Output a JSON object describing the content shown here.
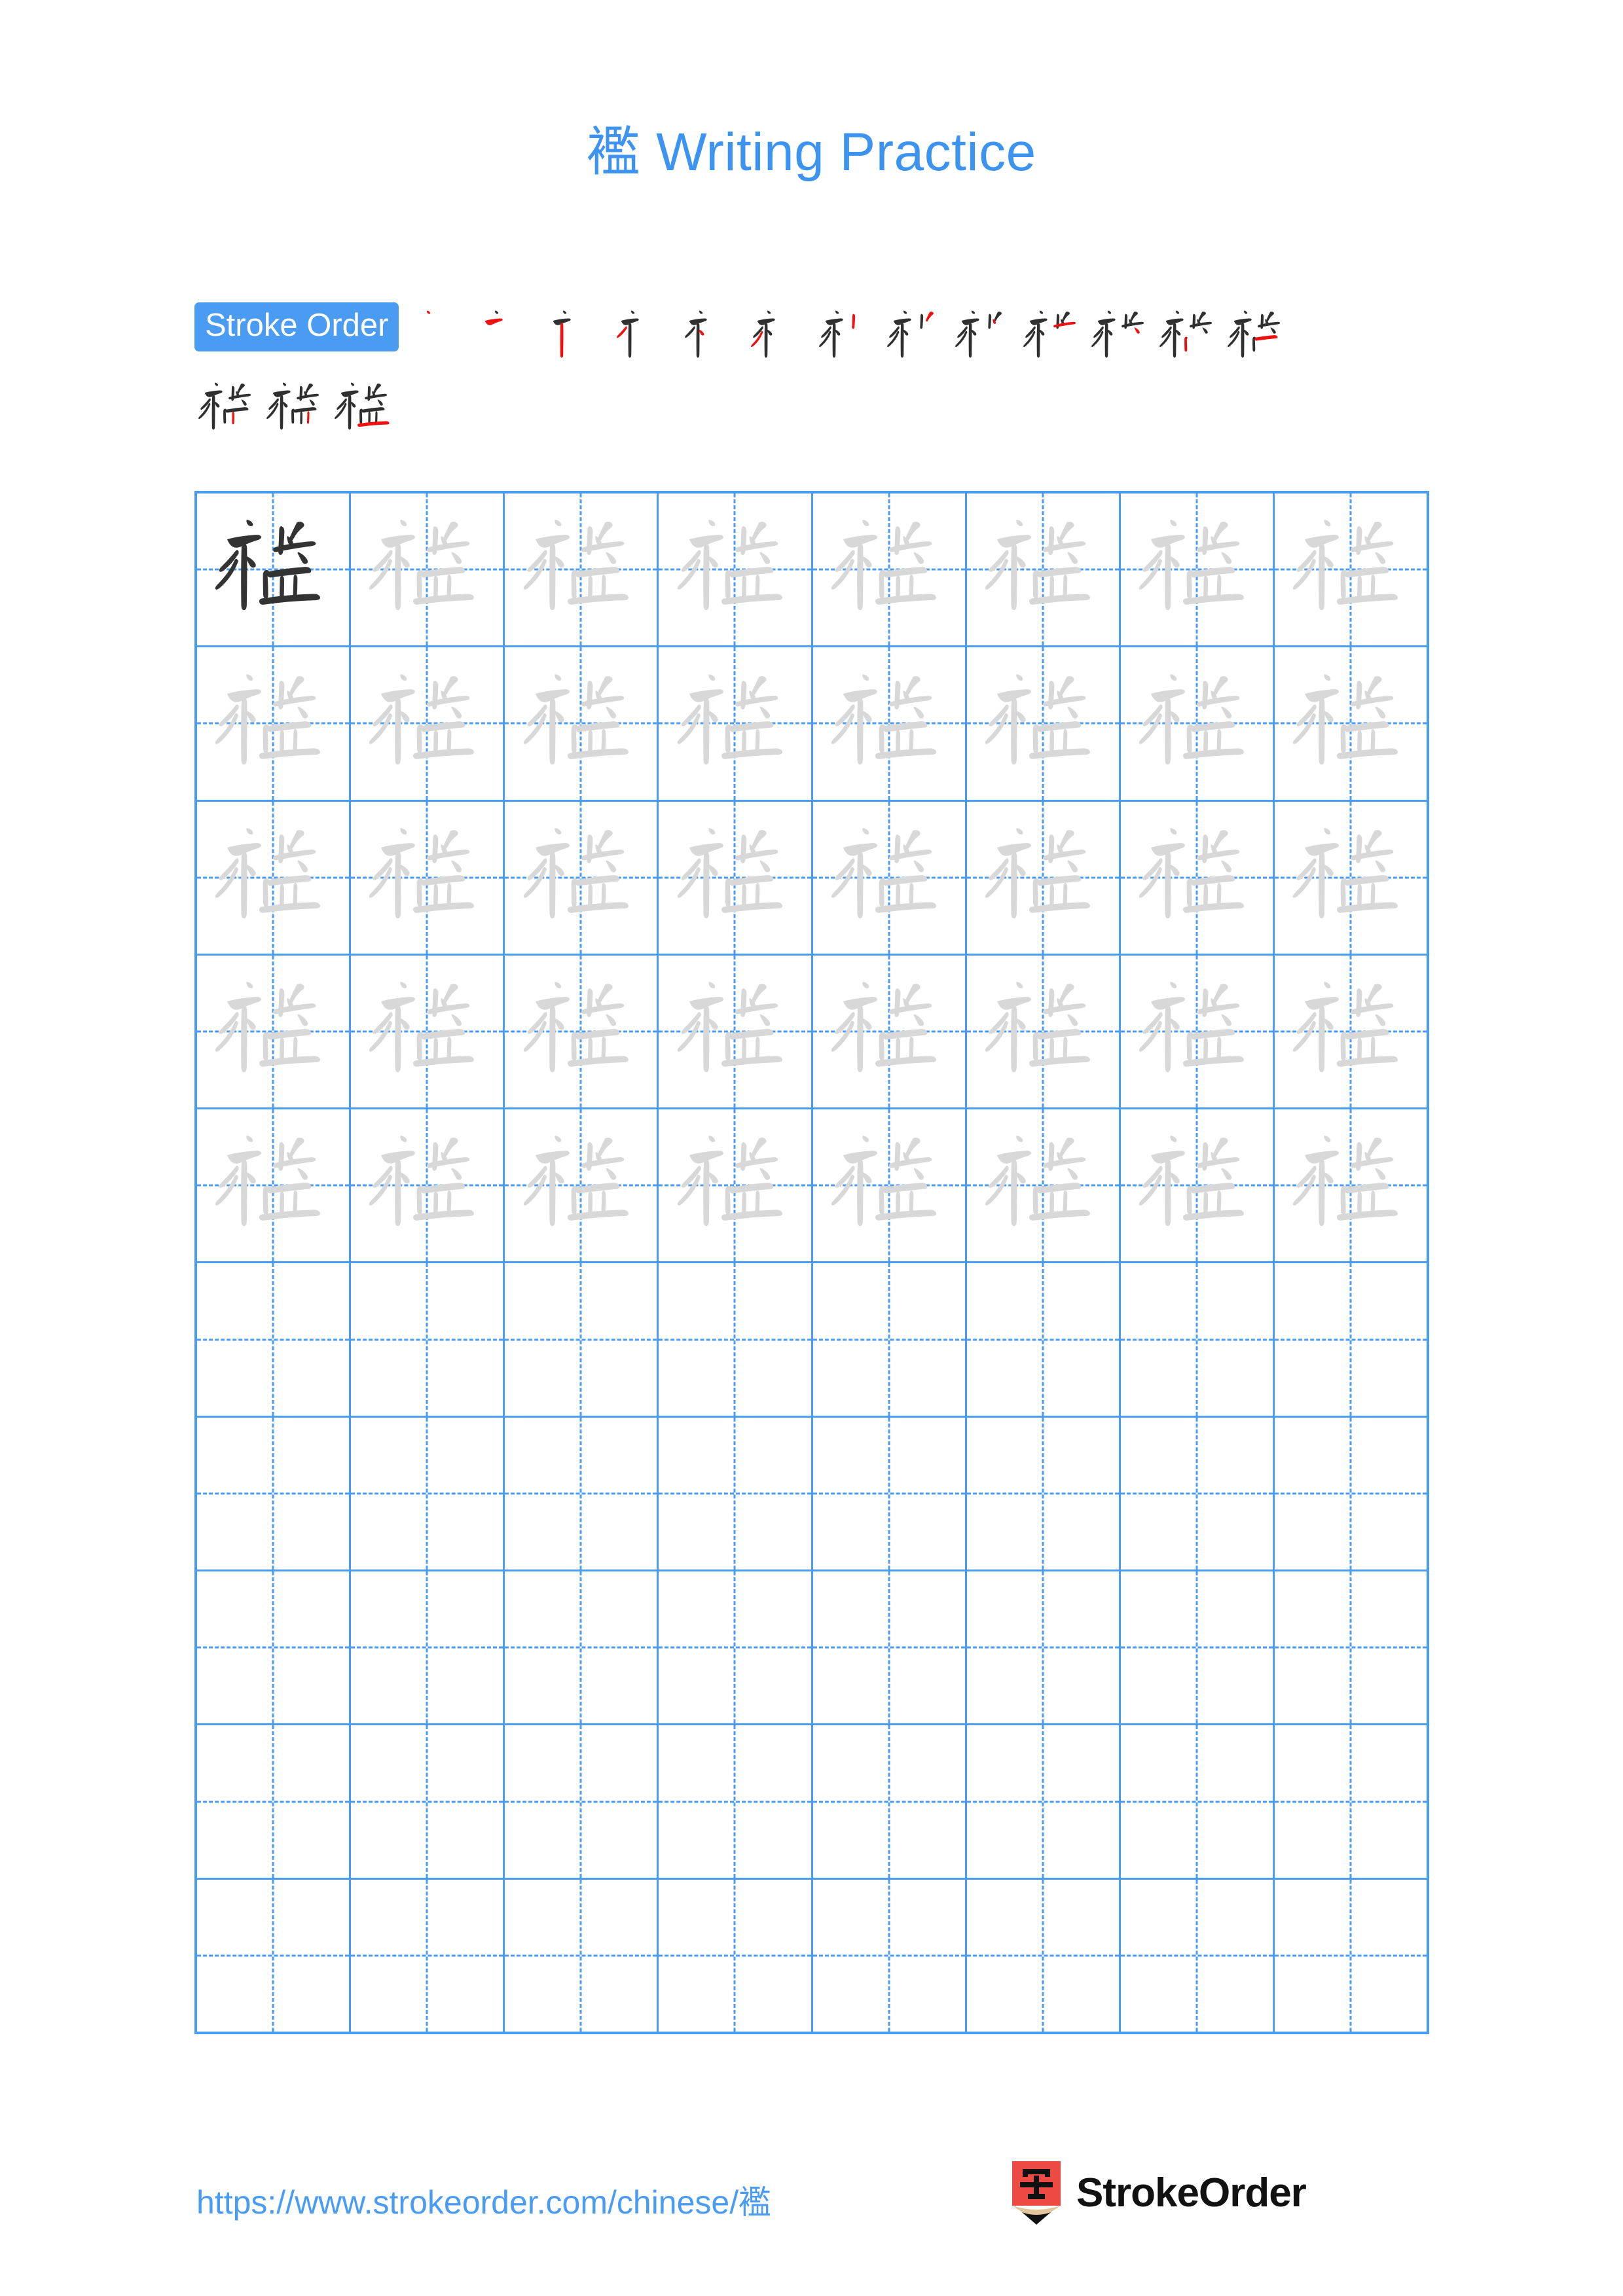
{
  "page": {
    "character": "襤",
    "title_suffix": " Writing Practice",
    "title_full": "襤 Writing Practice",
    "accent_color": "#4a9bf2",
    "trace_color": "#d8d8d8",
    "ink_color": "#333333",
    "new_stroke_color": "#ee1111"
  },
  "stroke_order": {
    "badge_label": "Stroke Order",
    "total_strokes": 16,
    "rows": [
      {
        "count": 13,
        "steps": [
          1,
          2,
          3,
          4,
          5,
          6,
          7,
          8,
          9,
          10,
          11,
          12,
          13
        ]
      },
      {
        "count": 3,
        "steps": [
          14,
          15,
          16
        ]
      }
    ]
  },
  "practice_grid": {
    "columns": 8,
    "rows": 10,
    "filled_rows": 5,
    "empty_rows": 5,
    "model_cell": {
      "row": 1,
      "column": 1,
      "style": "dark"
    },
    "trace_style": "light",
    "guide_lines": "dashed-crosshair"
  },
  "footer": {
    "url": "https://www.strokeorder.com/chinese/襤",
    "brand_name": "StrokeOrder",
    "logo_character": "字",
    "logo_body_color": "#ec4a42",
    "logo_wood_color": "#e3c59b",
    "logo_tip_color": "#111111"
  }
}
